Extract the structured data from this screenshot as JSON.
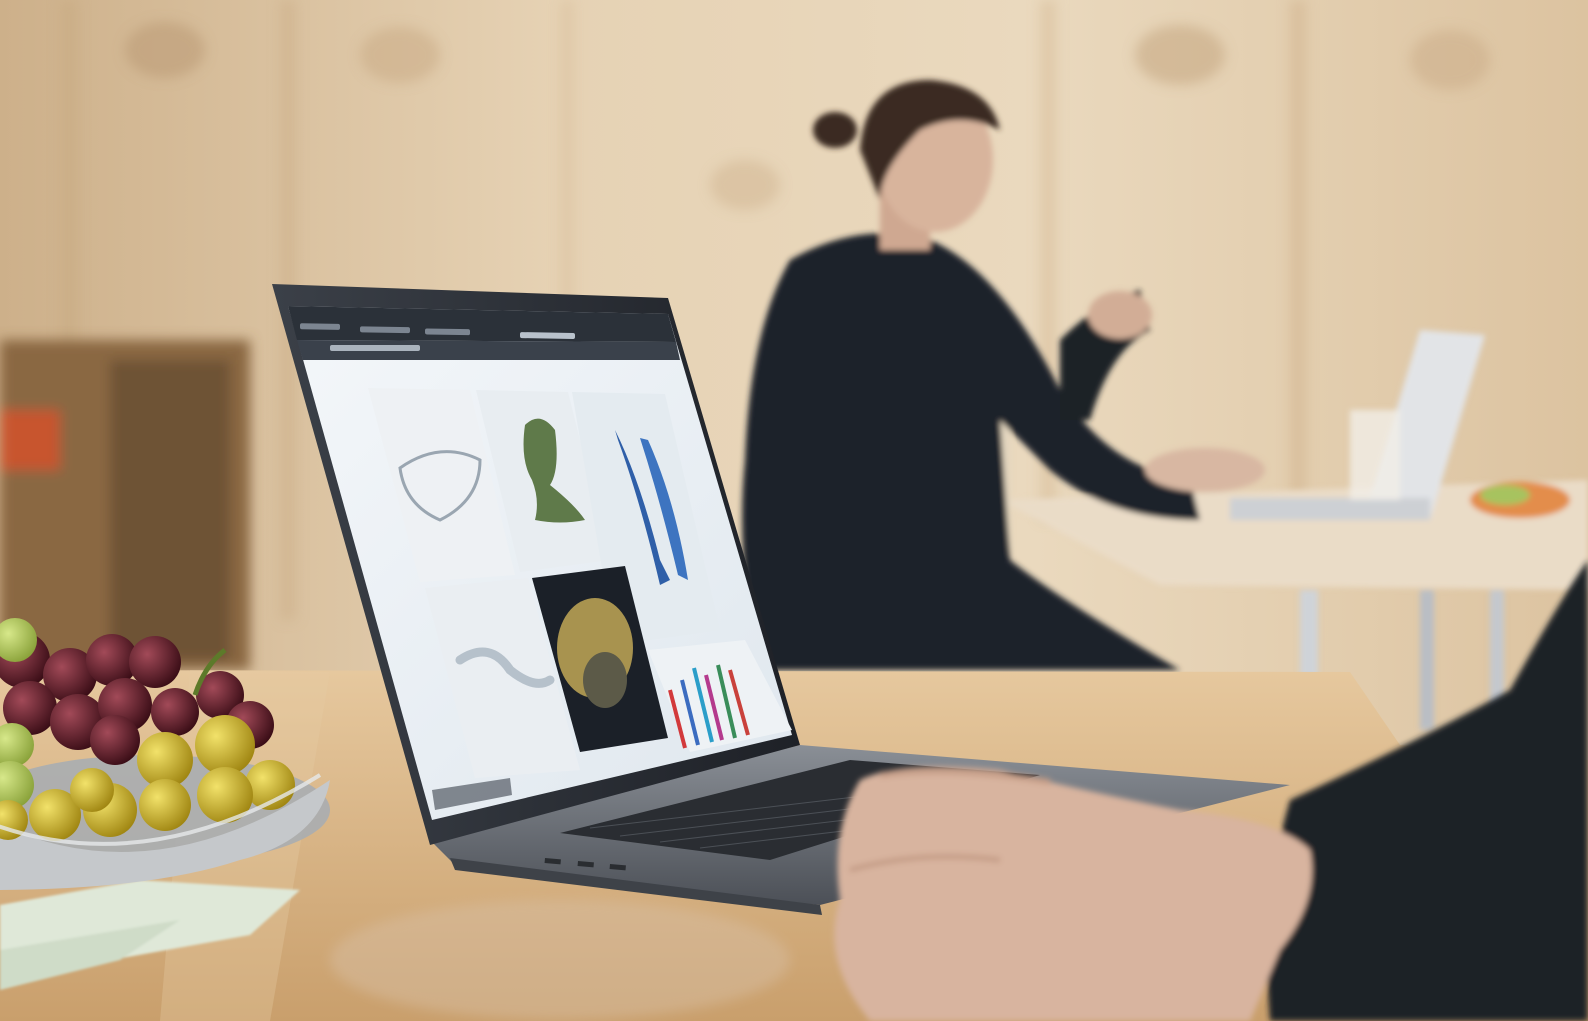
{
  "scene": {
    "description_colors": {
      "wall": "#d8bf9c",
      "wall_light": "#e9d7bd",
      "table": "#d9b585",
      "table_far": "#e2c9a4",
      "laptop_body": "#6e7379",
      "laptop_dark": "#2a2d32",
      "screen_bg": "#eef3f7",
      "browser_bar": "#2b3139",
      "person_clothing": "#1f242b",
      "skin": "#d9b8a3",
      "grape_red": "#5a1a24",
      "grape_green": "#c9b42a",
      "bowl": "#b9bcbf"
    },
    "icons": [
      "laptop",
      "browser-window",
      "image-grid",
      "grapes-bowl",
      "person-background",
      "hand-foreground"
    ]
  }
}
